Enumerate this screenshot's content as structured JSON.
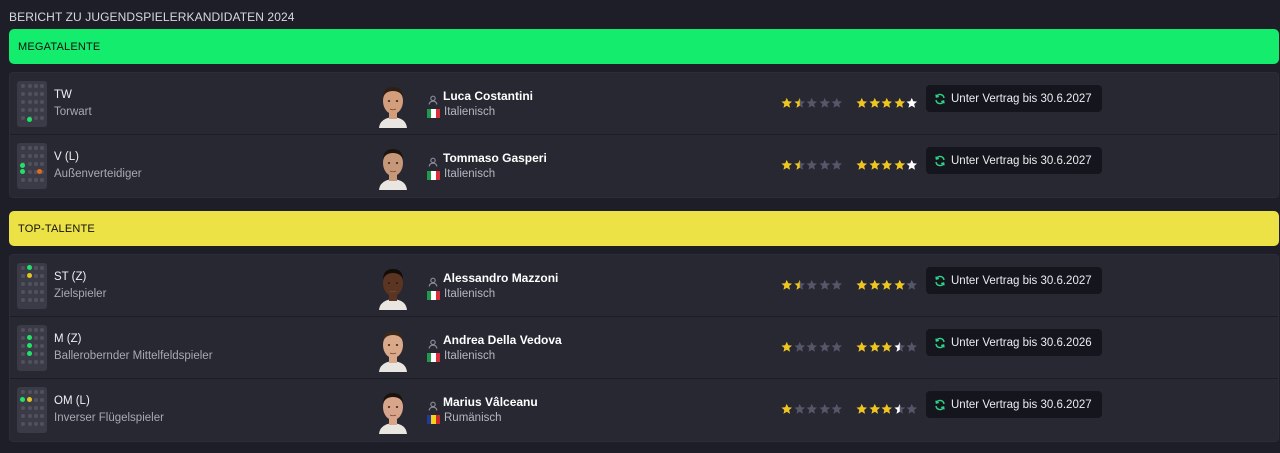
{
  "page": {
    "title": "BERICHT ZU JUGENDSPIELERKANDIDATEN 2024"
  },
  "colors": {
    "mega": "#13ec6c",
    "top": "#ece245",
    "star": "#f0c61e",
    "star_empty": "#55566a",
    "potential_extra": "#ffffff",
    "contract_icon": "#2fd488"
  },
  "icons": {
    "contract": "refresh-icon",
    "player": "person-icon"
  },
  "sections": [
    {
      "label": "MEGATALENTE",
      "color": "#13ec6c",
      "players": [
        {
          "pos": "TW",
          "role": "Torwart",
          "name": "Luca Costantini",
          "nation": "Italienisch",
          "flag": [
            "#1f9a48",
            "#ffffff",
            "#d7323c"
          ],
          "ca": 1.5,
          "pa": 5,
          "contract": "Unter Vertrag bis 30.6.2027",
          "dots": [
            {
              "pos": "gk",
              "color": "#1ee368"
            }
          ],
          "skin": "#d39e7c",
          "hair": "#2e1f16"
        },
        {
          "pos": "V (L)",
          "role": "Außenverteidiger",
          "name": "Tommaso Gasperi",
          "nation": "Italienisch",
          "flag": [
            "#1f9a48",
            "#ffffff",
            "#d7323c"
          ],
          "ca": 1.5,
          "pa": 5,
          "contract": "Unter Vertrag bis 30.6.2027",
          "dots": [
            {
              "pos": "dl",
              "color": "#1ee368"
            },
            {
              "pos": "wbl",
              "color": "#1ee368"
            },
            {
              "pos": "dr",
              "color": "#e56a1e"
            }
          ],
          "skin": "#c7977a",
          "hair": "#1d140e"
        }
      ]
    },
    {
      "label": "TOP-TALENTE",
      "color": "#ece245",
      "players": [
        {
          "pos": "ST (Z)",
          "role": "Zielspieler",
          "name": "Alessandro Mazzoni",
          "nation": "Italienisch",
          "flag": [
            "#1f9a48",
            "#ffffff",
            "#d7323c"
          ],
          "ca": 1.5,
          "pa": 4,
          "contract": "Unter Vertrag bis 30.6.2027",
          "dots": [
            {
              "pos": "st",
              "color": "#1ee368"
            },
            {
              "pos": "amc",
              "color": "#e2c424"
            }
          ],
          "skin": "#5b3522",
          "hair": "#120b08"
        },
        {
          "pos": "M (Z)",
          "role": "Ballerobernder Mittelfeldspieler",
          "name": "Andrea Della Vedova",
          "nation": "Italienisch",
          "flag": [
            "#1f9a48",
            "#ffffff",
            "#d7323c"
          ],
          "ca": 1,
          "pa": 3.5,
          "contract": "Unter Vertrag bis 30.6.2026",
          "dots": [
            {
              "pos": "amc",
              "color": "#1ee368"
            },
            {
              "pos": "mc",
              "color": "#1ee368"
            },
            {
              "pos": "dm",
              "color": "#1ee368"
            }
          ],
          "skin": "#d9a98a",
          "hair": "#3a281b"
        },
        {
          "pos": "OM (L)",
          "role": "Inverser Flügelspieler",
          "name": "Marius Vâlceanu",
          "nation": "Rumänisch",
          "flag": [
            "#1e3a9a",
            "#f4d21a",
            "#cf2a2a"
          ],
          "ca": 1,
          "pa": 3.5,
          "contract": "Unter Vertrag bis 30.6.2027",
          "dots": [
            {
              "pos": "amc",
              "color": "#e2c424"
            },
            {
              "pos": "aml",
              "color": "#1ee368"
            }
          ],
          "skin": "#d8a58a",
          "hair": "#1a120d"
        }
      ]
    }
  ]
}
